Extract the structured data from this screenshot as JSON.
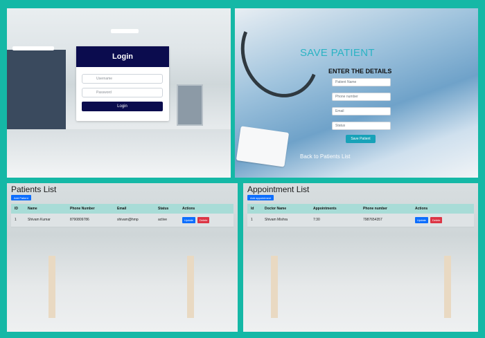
{
  "login": {
    "title": "Login",
    "username_placeholder": "Username",
    "password_placeholder": "Password",
    "button_label": "Login"
  },
  "save_patient": {
    "title": "SAVE PATIENT",
    "subtitle": "ENTER THE DETAILS",
    "fields": [
      {
        "placeholder": "Patient Name"
      },
      {
        "placeholder": "Phone number"
      },
      {
        "placeholder": "Email"
      },
      {
        "placeholder": "Status"
      }
    ],
    "button_label": "Save Patient",
    "back_link": "Back to Patients List"
  },
  "patients": {
    "title": "Patients List",
    "add_label": "Add Patient",
    "columns": [
      "ID",
      "Name",
      "Phone Number",
      "Email",
      "Status",
      "Actions"
    ],
    "rows": [
      {
        "id": "1",
        "name": "Shivam Kumar",
        "phone": "8790809786",
        "email": "shivam@hmp",
        "status": "active"
      }
    ],
    "update_label": "Update",
    "delete_label": "Delete"
  },
  "appointments": {
    "title": "Appointment List",
    "add_label": "Add appointment",
    "columns": [
      "Id",
      "Doctor Name",
      "Appointments",
      "Phone number",
      "Actions"
    ],
    "rows": [
      {
        "id": "1",
        "doctor": "Shivam Mishra",
        "time": "7:30",
        "phone": "7987654357"
      }
    ],
    "update_label": "Update",
    "delete_label": "Delete"
  },
  "colors": {
    "frame": "#15b8a6",
    "login_navy": "#0b0c4e",
    "accent_teal": "#17a2b8",
    "update_blue": "#0d6efd",
    "delete_red": "#dc3545"
  }
}
